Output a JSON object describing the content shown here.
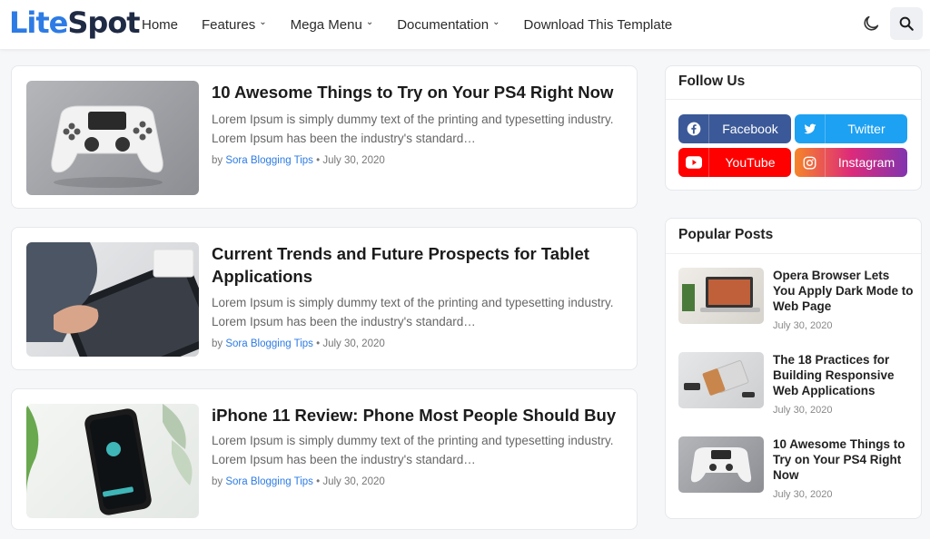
{
  "header": {
    "logo_part1": "Lite",
    "logo_part2": "Spot",
    "nav": [
      {
        "label": "Home",
        "dropdown": false
      },
      {
        "label": "Features",
        "dropdown": true
      },
      {
        "label": "Mega Menu",
        "dropdown": true
      },
      {
        "label": "Documentation",
        "dropdown": true
      },
      {
        "label": "Download This Template",
        "dropdown": false
      }
    ],
    "icons": {
      "theme": "moon-icon",
      "search": "search-icon"
    }
  },
  "posts": [
    {
      "title": "10 Awesome Things to Try on Your PS4 Right Now",
      "excerpt": "Lorem Ipsum is simply dummy text of the printing and typesetting industry. Lorem Ipsum has been the industry's standard…",
      "by": "by",
      "author": "Sora Blogging Tips",
      "date": "July 30, 2020"
    },
    {
      "title": "Current Trends and Future Prospects for Tablet Applications",
      "excerpt": "Lorem Ipsum is simply dummy text of the printing and typesetting industry. Lorem Ipsum has been the industry's standard…",
      "by": "by",
      "author": "Sora Blogging Tips",
      "date": "July 30, 2020"
    },
    {
      "title": "iPhone 11 Review: Phone Most People Should Buy",
      "excerpt": "Lorem Ipsum is simply dummy text of the printing and typesetting industry. Lorem Ipsum has been the industry's standard…",
      "by": "by",
      "author": "Sora Blogging Tips",
      "date": "July 30, 2020"
    }
  ],
  "follow": {
    "title": "Follow Us",
    "items": [
      {
        "label": "Facebook",
        "icon": "facebook-icon",
        "color": "#3b5998"
      },
      {
        "label": "Twitter",
        "icon": "twitter-icon",
        "color": "#1da1f2"
      },
      {
        "label": "YouTube",
        "icon": "youtube-icon",
        "color": "#ff0000"
      },
      {
        "label": "Instagram",
        "icon": "instagram-icon",
        "color": "#e1306c"
      }
    ]
  },
  "popular": {
    "title": "Popular Posts",
    "items": [
      {
        "title": "Opera Browser Lets You Apply Dark Mode to Web Page",
        "date": "July 30, 2020"
      },
      {
        "title": "The 18 Practices for Building Responsive Web Applications",
        "date": "July 30, 2020"
      },
      {
        "title": "10 Awesome Things to Try on Your PS4 Right Now",
        "date": "July 30, 2020"
      }
    ]
  },
  "colors": {
    "brand_blue": "#2d7be5",
    "logo_dark": "#1f2a44"
  }
}
